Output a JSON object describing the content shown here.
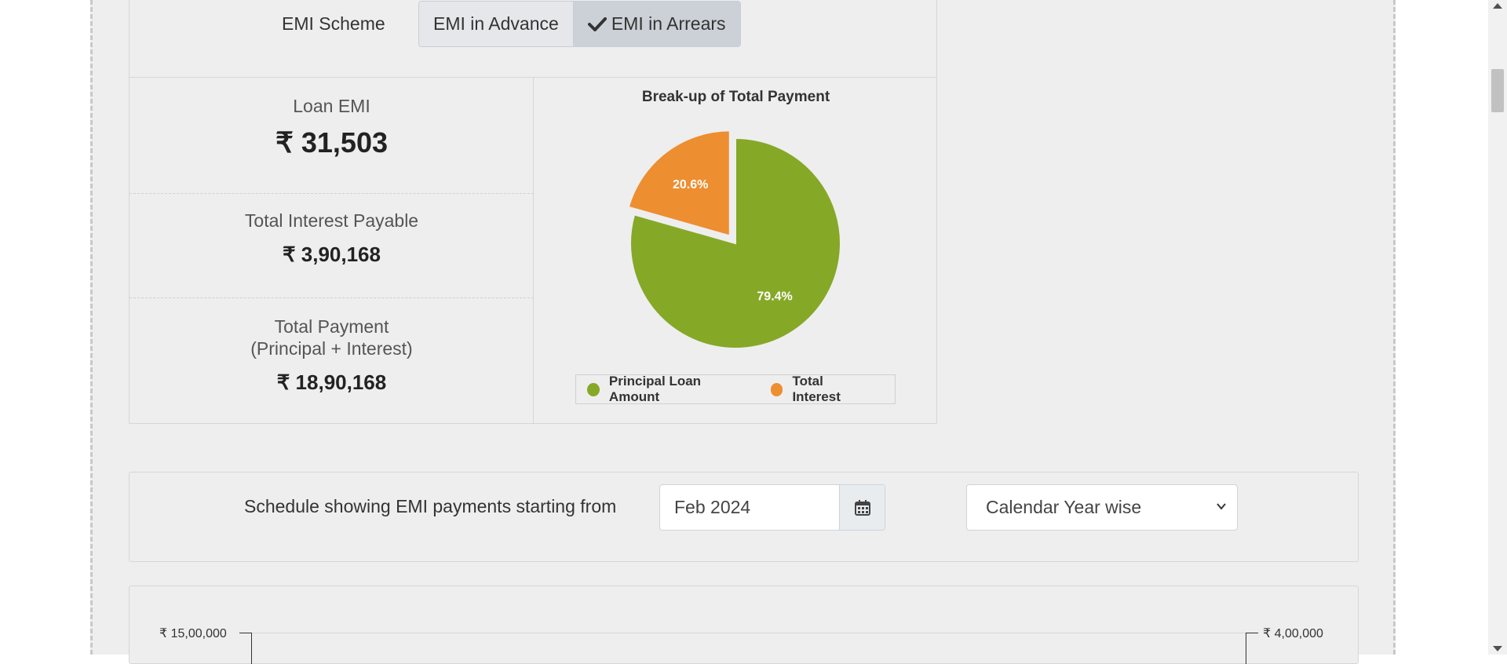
{
  "emi_scheme": {
    "label": "EMI Scheme",
    "options": [
      "EMI in Advance",
      "EMI in Arrears"
    ],
    "selected": "EMI in Arrears"
  },
  "results": {
    "loan_emi_label": "Loan EMI",
    "loan_emi_value": "₹ 31,503",
    "total_interest_label": "Total Interest Payable",
    "total_interest_value": "₹ 3,90,168",
    "total_payment_label_line1": "Total Payment",
    "total_payment_label_line2": "(Principal + Interest)",
    "total_payment_value": "₹ 18,90,168"
  },
  "chart_data": {
    "type": "pie",
    "title": "Break-up of Total Payment",
    "slices": [
      {
        "name": "Principal Loan Amount",
        "value": 79.4,
        "label": "79.4%",
        "color": "#86a827"
      },
      {
        "name": "Total Interest",
        "value": 20.6,
        "label": "20.6%",
        "color": "#ed8e30"
      }
    ],
    "legend": "bottom"
  },
  "schedule": {
    "label": "Schedule showing EMI payments starting from",
    "start_value": "Feb 2024",
    "view_selected": "Calendar Year wise"
  },
  "bottom_chart": {
    "left_axis_top": "₹ 15,00,000",
    "right_axis_top": "₹ 4,00,000"
  },
  "icons": {
    "check": "check-icon",
    "calendar": "calendar-icon",
    "dropdown": "chevron-down-icon"
  }
}
